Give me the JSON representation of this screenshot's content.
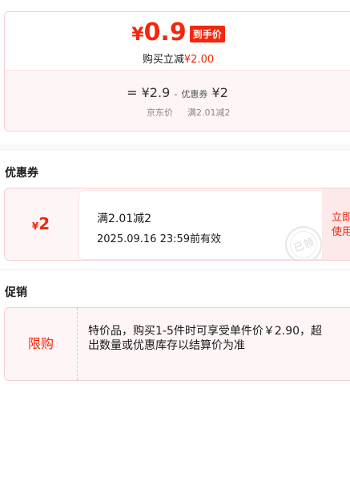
{
  "price_card": {
    "final_currency": "¥",
    "final_price": "0.9",
    "final_tag": "到手价",
    "instant_label": "购买立减",
    "instant_amount": "¥2.00",
    "calc": {
      "eq": "=",
      "jd_price": "¥2.9",
      "minus": "-",
      "coupon_word": "优惠券",
      "coupon_value": "¥2"
    },
    "labels": {
      "jd_price": "京东价",
      "coupon_rule": "满2.01减2"
    }
  },
  "coupon_section": {
    "title": "优惠券",
    "coupon": {
      "currency": "¥",
      "value": "2",
      "rule": "满2.01减2",
      "expiry": "2025.09.16 23:59前有效",
      "stamp": "已领",
      "action": "立即使用"
    }
  },
  "promo_section": {
    "title": "促销",
    "promo": {
      "tag": "限购",
      "description": "特价品，购买1-5件时可享受单件价￥2.90，超出数量或优惠库存以结算价为准"
    }
  },
  "colors": {
    "accent": "#f2270c",
    "card_bg": "#fef5f6",
    "border": "#f6cfd3"
  }
}
